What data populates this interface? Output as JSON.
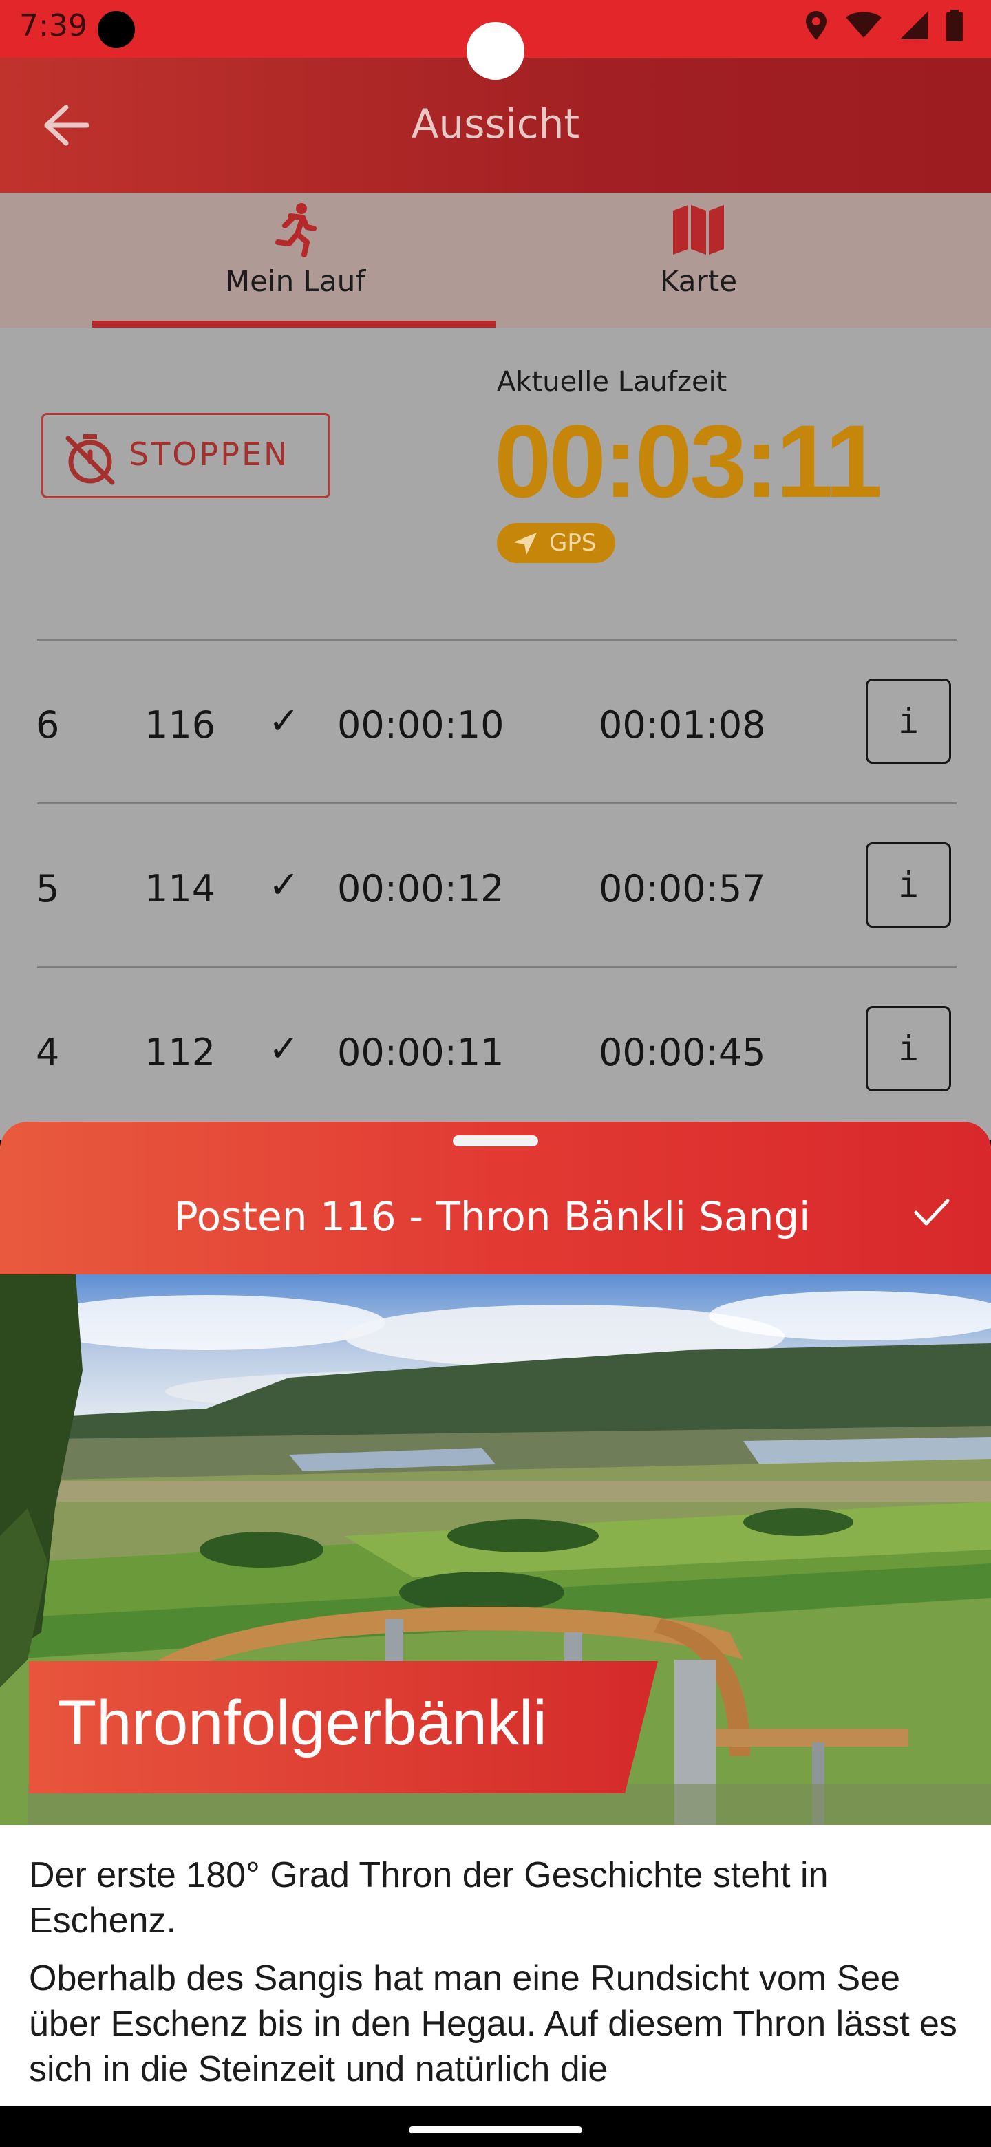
{
  "status_bar": {
    "time": "7:39"
  },
  "app_bar": {
    "title": "Aussicht"
  },
  "tabs": [
    {
      "label": "Mein Lauf",
      "icon": "runner-icon",
      "selected": true
    },
    {
      "label": "Karte",
      "icon": "map-icon",
      "selected": false
    }
  ],
  "run": {
    "stop_label": "STOPPEN",
    "time_caption": "Aktuelle Laufzeit",
    "time_value": "00:03:11",
    "gps_label": "GPS",
    "accent_color": "#c6860a"
  },
  "checkpoints": [
    {
      "num": "6",
      "post": "116",
      "check": "✓",
      "split": "00:00:10",
      "total": "00:01:08",
      "info": "i"
    },
    {
      "num": "5",
      "post": "114",
      "check": "✓",
      "split": "00:00:12",
      "total": "00:00:57",
      "info": "i"
    },
    {
      "num": "4",
      "post": "112",
      "check": "✓",
      "split": "00:00:11",
      "total": "00:00:45",
      "info": "i"
    }
  ],
  "sheet": {
    "title": "Posten 116 - Thron Bänkli Sangi",
    "banner": "Thronfolgerbänkli",
    "paragraph1": "Der erste 180° Grad Thron der Geschichte steht in Eschenz.",
    "paragraph2": "Oberhalb des Sangis hat man eine Rundsicht vom See über Eschenz bis in den Hegau. Auf diesem Thron lässt es sich in die Steinzeit und natürlich die"
  },
  "colors": {
    "brand_red": "#e2262a",
    "app_bar": "#a22023",
    "tab_bg": "#b09a96",
    "content_bg": "#a7a7a7"
  }
}
